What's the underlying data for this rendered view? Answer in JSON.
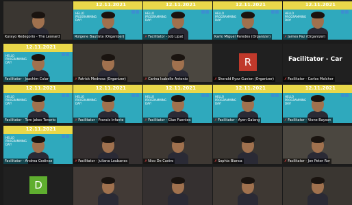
{
  "meeting": {
    "date": "12.11.2021",
    "background_text": "HELLO PROGRAMMING DAY!",
    "muted_icon": "mic-off-icon",
    "colors": {
      "banner_blue": "#2fa9bd",
      "banner_yellow": "#e9d84a",
      "muted_red": "#e04040",
      "avatar_r": "#c0392b",
      "avatar_d": "#5fae2f"
    }
  },
  "participants": [
    {
      "label": "Kurayo Redegorio - The Leonard",
      "muted": false,
      "kind": "cam"
    },
    {
      "label": "Rolgene Bautista (Organizer)",
      "muted": false,
      "kind": "banner"
    },
    {
      "label": "Facilitator - Job Lipat",
      "muted": true,
      "kind": "banner"
    },
    {
      "label": "Karlo Miguel Paredes (Organizer)",
      "muted": false,
      "kind": "banner"
    },
    {
      "label": "James Paz (Organizer)",
      "muted": true,
      "kind": "banner"
    },
    {
      "label": "Facilitator - Joachim Colar",
      "muted": false,
      "kind": "banner"
    },
    {
      "label": "Patrick Medrosa (Organizer)",
      "muted": true,
      "kind": "cam"
    },
    {
      "label": "Carina Isabelle Antonio",
      "muted": true,
      "kind": "cam"
    },
    {
      "label": "Sherald Ryxz Gunion (Organizer)",
      "muted": true,
      "kind": "avatar",
      "initial": "R"
    },
    {
      "label": "Facilitator - Carlos Melchor",
      "muted": true,
      "kind": "name",
      "display": "Facilitator - Car"
    },
    {
      "label": "Facilitator - Tom Jakov Tenorio",
      "muted": false,
      "kind": "banner"
    },
    {
      "label": "Facilitator - Francis Infante",
      "muted": true,
      "kind": "banner"
    },
    {
      "label": "Facilitator - Gian Fuentes",
      "muted": true,
      "kind": "banner"
    },
    {
      "label": "Facilitator - Ayen Galang",
      "muted": true,
      "kind": "banner"
    },
    {
      "label": "Facilitator - Vione Bayson",
      "muted": true,
      "kind": "banner"
    },
    {
      "label": "Facilitator - Andrea Godinez",
      "muted": false,
      "kind": "banner"
    },
    {
      "label": "Facilitator - Juliana Loubanes",
      "muted": true,
      "kind": "cam"
    },
    {
      "label": "Nico De Castro",
      "muted": true,
      "kind": "cam"
    },
    {
      "label": "Sophia Bianca",
      "muted": true,
      "kind": "cam"
    },
    {
      "label": "Facilitator - Jon Peter Ror",
      "muted": true,
      "kind": "cam"
    },
    {
      "label": "",
      "muted": false,
      "kind": "avatar",
      "initial": "D"
    },
    {
      "label": "",
      "muted": false,
      "kind": "cam"
    },
    {
      "label": "",
      "muted": false,
      "kind": "cam"
    },
    {
      "label": "",
      "muted": false,
      "kind": "cam"
    },
    {
      "label": "",
      "muted": false,
      "kind": "cam"
    }
  ]
}
